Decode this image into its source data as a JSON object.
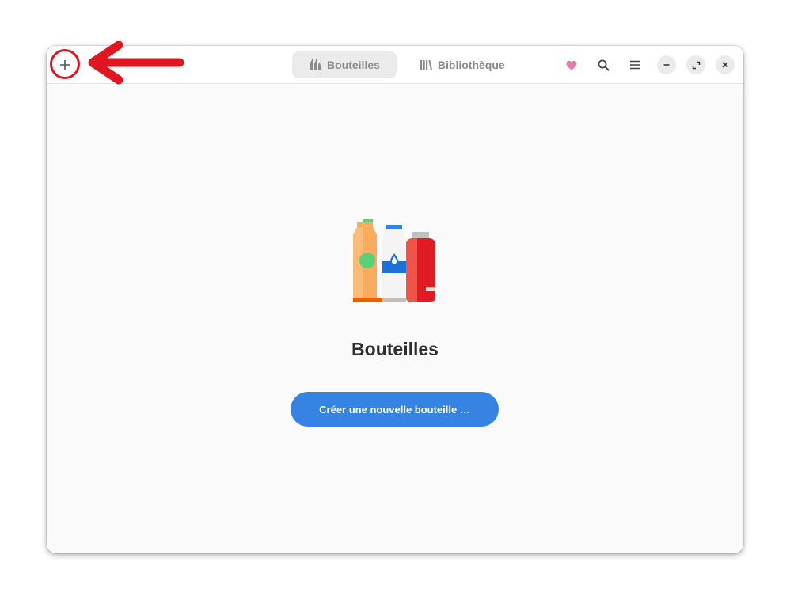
{
  "header": {
    "add_icon": "plus-icon",
    "tabs": [
      {
        "label": "Bouteilles",
        "icon": "bottles-icon",
        "active": true
      },
      {
        "label": "Bibliothèque",
        "icon": "library-icon",
        "active": false
      }
    ],
    "actions": [
      "heart-icon",
      "search-icon",
      "menu-icon"
    ],
    "window_controls": [
      "minimize-icon",
      "maximize-icon",
      "close-icon"
    ]
  },
  "main": {
    "title": "Bouteilles",
    "create_button_label": "Créer une nouvelle bouteille …",
    "illustration": "bottles-illustration"
  },
  "annotation": {
    "shape": "red circle and arrow",
    "color": "#e0151f"
  },
  "colors": {
    "accent": "#3584e4",
    "heart": "#e27dab",
    "annotation": "#e0151f"
  }
}
